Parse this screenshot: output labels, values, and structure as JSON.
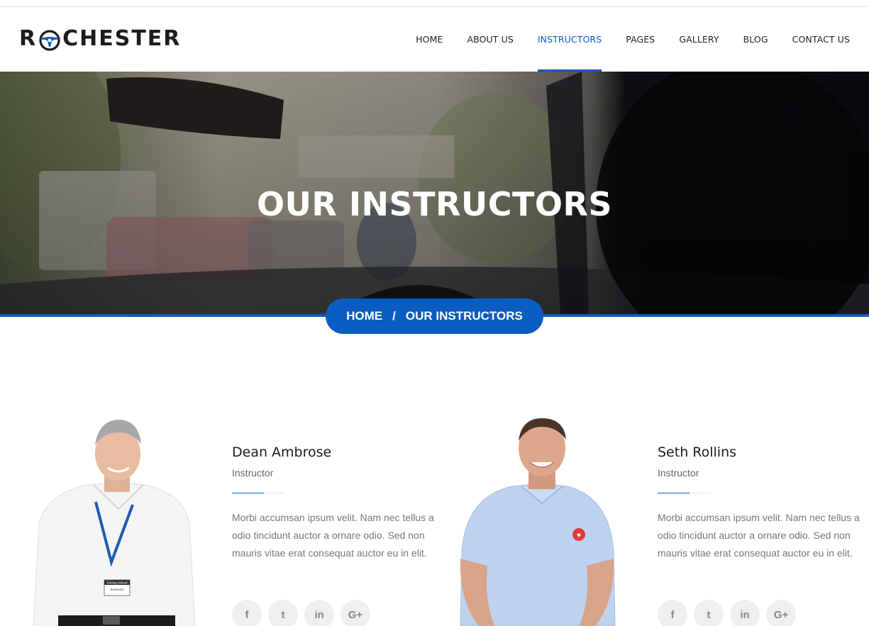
{
  "brand": {
    "logo_text_left": "R",
    "logo_text_right": "CHESTER"
  },
  "nav": {
    "items": [
      {
        "label": "HOME"
      },
      {
        "label": "ABOUT US"
      },
      {
        "label": "INSTRUCTORS"
      },
      {
        "label": "PAGES"
      },
      {
        "label": "GALLERY"
      },
      {
        "label": "BLOG"
      },
      {
        "label": "CONTACT US"
      }
    ],
    "active": "INSTRUCTORS"
  },
  "hero": {
    "title": "OUR INSTRUCTORS"
  },
  "breadcrumb": {
    "home": "HOME",
    "separator": "/",
    "current": "OUR INSTRUCTORS"
  },
  "instructors": [
    {
      "name": "Dean Ambrose",
      "role": "Instructor",
      "description": "Morbi accumsan ipsum velit. Nam nec tellus a odio tincidunt auctor a ornare odio. Sed non mauris vitae erat consequat auctor eu in elit.",
      "badge_line1": "Driving School",
      "badge_line2": "Instructor"
    },
    {
      "name": "Seth Rollins",
      "role": "Instructor",
      "description": "Morbi accumsan ipsum velit. Nam nec tellus a odio tincidunt auctor a ornare odio. Sed non mauris vitae erat consequat auctor eu in elit."
    }
  ],
  "social": {
    "facebook": "f",
    "twitter": "t",
    "linkedin": "in",
    "google": "G+"
  },
  "colors": {
    "accent": "#0b5cc2",
    "text_dark": "#1c1c1c",
    "text_muted": "#777777"
  },
  "icons": [
    "steering-wheel-icon",
    "facebook-icon",
    "twitter-icon",
    "linkedin-icon",
    "google-plus-icon"
  ]
}
